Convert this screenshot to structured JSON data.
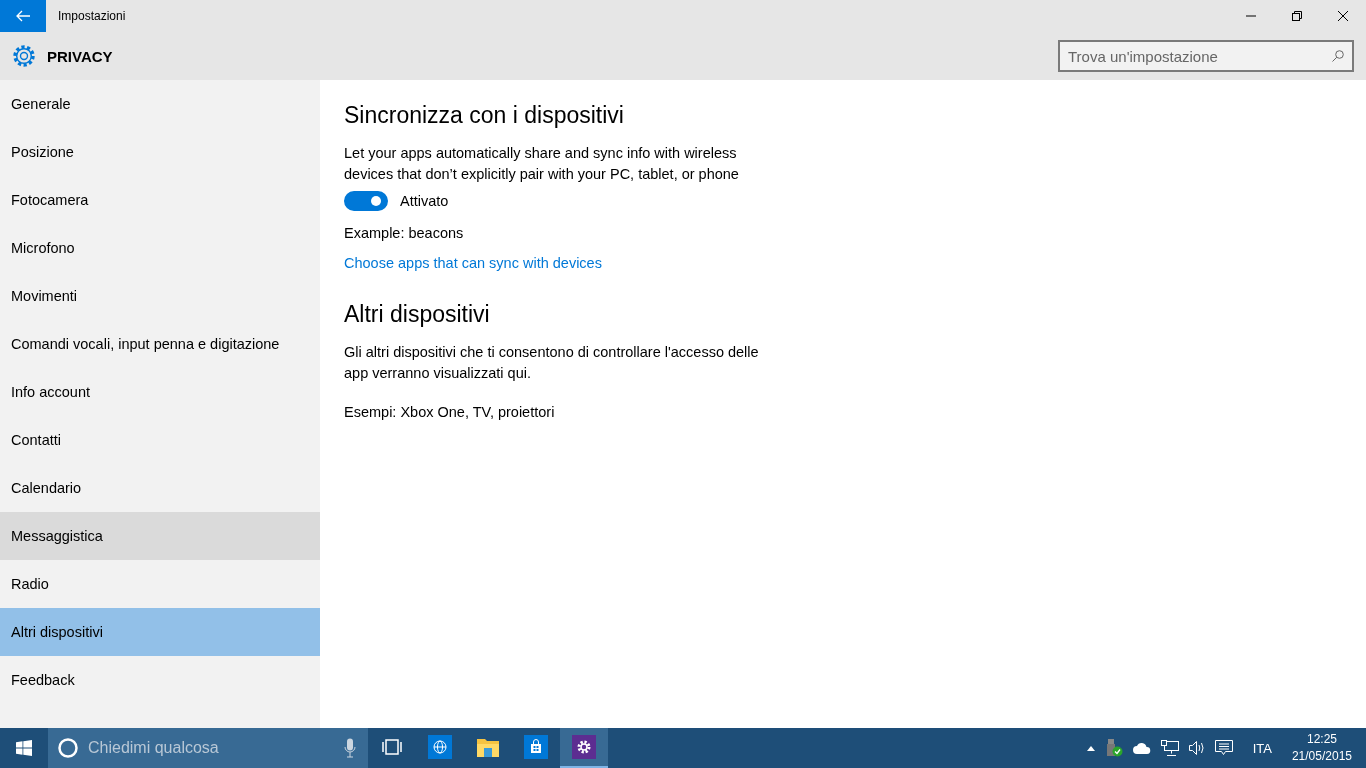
{
  "window": {
    "title": "Impostazioni"
  },
  "header": {
    "title": "PRIVACY",
    "search": {
      "placeholder": "Trova un'impostazione"
    }
  },
  "sidebar": {
    "items": [
      {
        "label": "Generale",
        "selected": false,
        "hovered": false
      },
      {
        "label": "Posizione",
        "selected": false,
        "hovered": false
      },
      {
        "label": "Fotocamera",
        "selected": false,
        "hovered": false
      },
      {
        "label": "Microfono",
        "selected": false,
        "hovered": false
      },
      {
        "label": "Movimenti",
        "selected": false,
        "hovered": false
      },
      {
        "label": "Comandi vocali, input penna e digitazione",
        "selected": false,
        "hovered": false
      },
      {
        "label": "Info account",
        "selected": false,
        "hovered": false
      },
      {
        "label": "Contatti",
        "selected": false,
        "hovered": false
      },
      {
        "label": "Calendario",
        "selected": false,
        "hovered": false
      },
      {
        "label": "Messaggistica",
        "selected": false,
        "hovered": true
      },
      {
        "label": "Radio",
        "selected": false,
        "hovered": false
      },
      {
        "label": "Altri dispositivi",
        "selected": true,
        "hovered": false
      },
      {
        "label": "Feedback",
        "selected": false,
        "hovered": false
      }
    ]
  },
  "sections": [
    {
      "title": "Sincronizza con i dispositivi",
      "description": "Let your apps automatically share and sync info with wireless devices that don’t explicitly pair with your PC, tablet, or phone",
      "toggle": {
        "on": true,
        "label": "Attivato"
      },
      "example": "Example: beacons",
      "link": "Choose apps that can sync with devices"
    },
    {
      "title": "Altri dispositivi",
      "description": "Gli altri dispositivi che ti consentono di controllare l'accesso delle app verranno visualizzati qui.",
      "example": "Esempi: Xbox One, TV, proiettori"
    }
  ],
  "taskbar": {
    "search_placeholder": "Chiedimi qualcosa",
    "apps": [
      {
        "kind": "taskview",
        "selected": false
      },
      {
        "kind": "browser",
        "selected": false
      },
      {
        "kind": "explorer",
        "selected": false
      },
      {
        "kind": "store",
        "selected": false
      },
      {
        "kind": "settings",
        "selected": true
      }
    ],
    "language": "ITA",
    "time": "12:25",
    "date": "21/05/2015"
  }
}
